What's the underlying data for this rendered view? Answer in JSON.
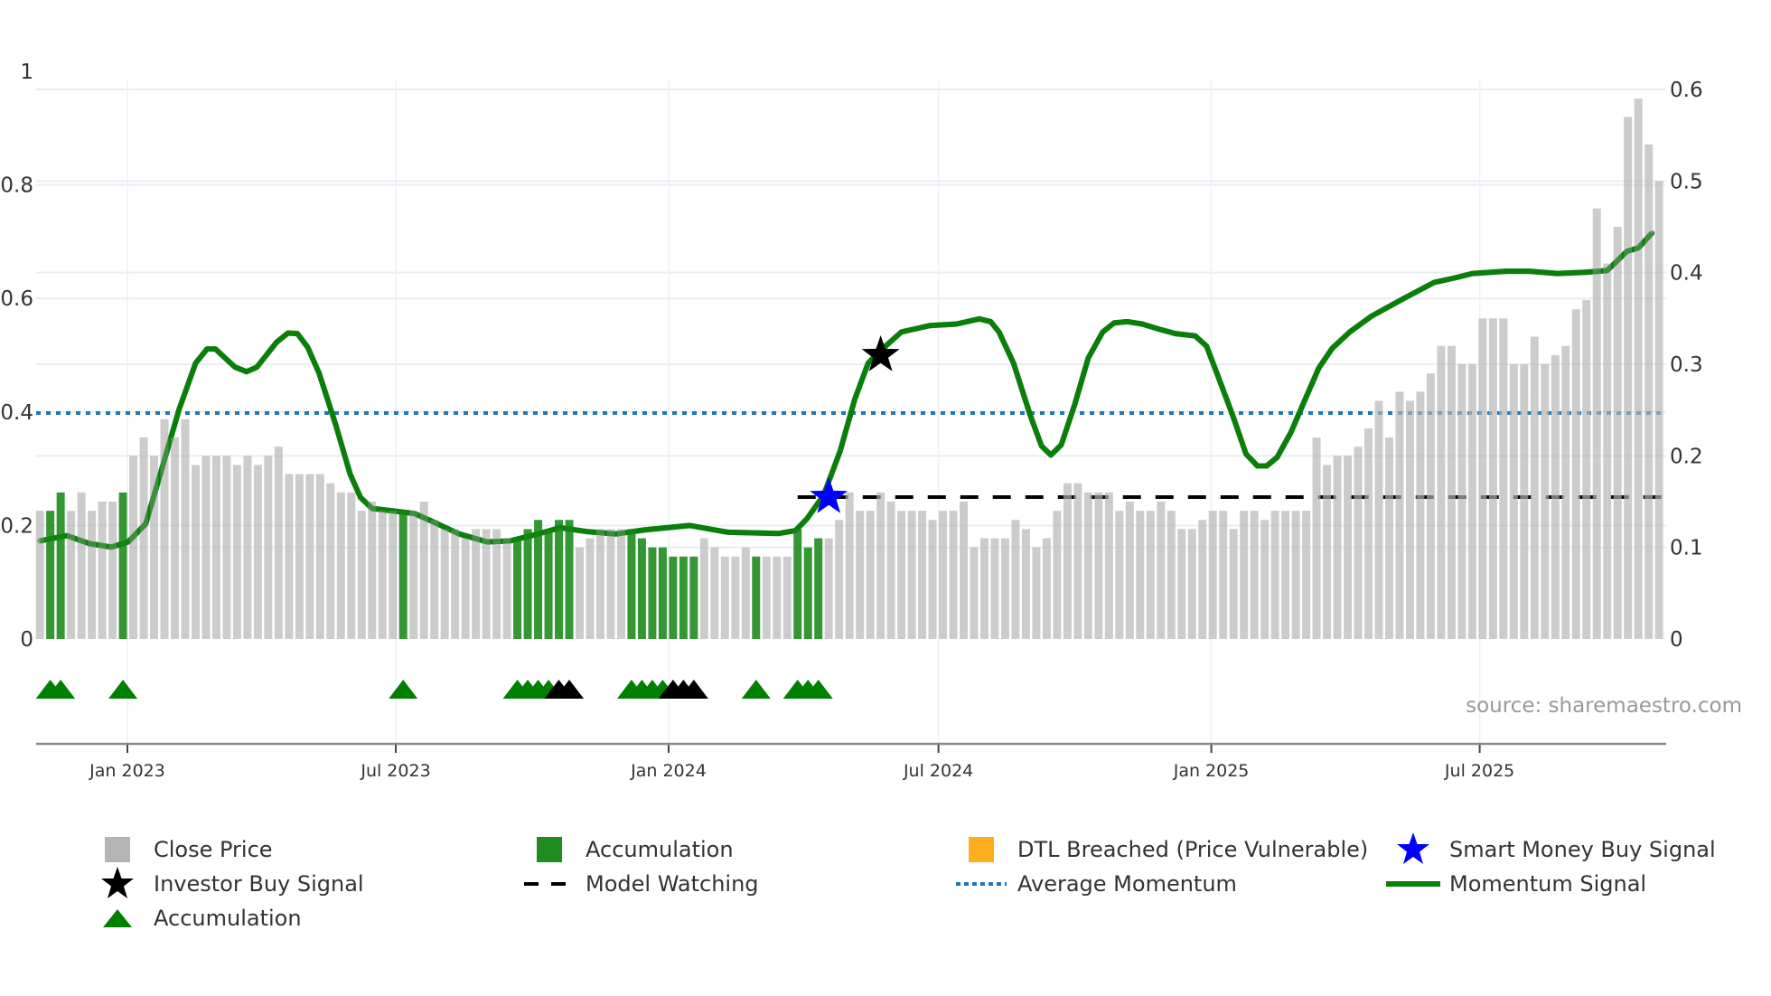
{
  "chart_data": {
    "type": "bar",
    "title": "",
    "source_label": "source: sharemaestro.com",
    "x_axis": {
      "type": "date",
      "ticks": [
        {
          "date": "2023-01-01",
          "label": "Jan 2023"
        },
        {
          "date": "2023-07-01",
          "label": "Jul 2023"
        },
        {
          "date": "2024-01-01",
          "label": "Jan 2024"
        },
        {
          "date": "2024-07-01",
          "label": "Jul 2024"
        },
        {
          "date": "2025-01-01",
          "label": "Jan 2025"
        },
        {
          "date": "2025-07-01",
          "label": "Jul 2025"
        }
      ]
    },
    "left_axis": {
      "range": [
        0,
        1
      ],
      "ticks": [
        "0",
        "0.2",
        "0.4",
        "0.6",
        "0.8",
        "1"
      ],
      "tick_values": [
        0,
        0.2,
        0.4,
        0.6,
        0.8,
        1
      ]
    },
    "right_axis": {
      "range": [
        0,
        0.6
      ],
      "ticks": [
        "0",
        "0.1",
        "0.2",
        "0.3",
        "0.4",
        "0.5",
        "0.6"
      ],
      "tick_values": [
        0,
        0.1,
        0.2,
        0.3,
        0.4,
        0.5,
        0.6
      ]
    },
    "close_price": {
      "axis": "right",
      "start_date": "2022-11-03",
      "interval_days": 7,
      "values": [
        0.14,
        0.14,
        0.16,
        0.14,
        0.16,
        0.14,
        0.15,
        0.15,
        0.16,
        0.2,
        0.22,
        0.2,
        0.24,
        0.22,
        0.24,
        0.19,
        0.2,
        0.2,
        0.2,
        0.19,
        0.2,
        0.19,
        0.2,
        0.21,
        0.18,
        0.18,
        0.18,
        0.18,
        0.17,
        0.16,
        0.16,
        0.14,
        0.15,
        0.14,
        0.14,
        0.14,
        0.14,
        0.15,
        0.13,
        0.12,
        0.12,
        0.11,
        0.12,
        0.12,
        0.12,
        0.11,
        0.11,
        0.12,
        0.13,
        0.12,
        0.13,
        0.13,
        0.1,
        0.11,
        0.12,
        0.12,
        0.12,
        0.12,
        0.11,
        0.1,
        0.1,
        0.09,
        0.09,
        0.09,
        0.11,
        0.1,
        0.09,
        0.09,
        0.1,
        0.09,
        0.09,
        0.09,
        0.09,
        0.12,
        0.1,
        0.11,
        0.11,
        0.13,
        0.16,
        0.14,
        0.14,
        0.16,
        0.15,
        0.14,
        0.14,
        0.14,
        0.13,
        0.14,
        0.14,
        0.15,
        0.1,
        0.11,
        0.11,
        0.11,
        0.13,
        0.12,
        0.1,
        0.11,
        0.14,
        0.17,
        0.17,
        0.16,
        0.16,
        0.16,
        0.14,
        0.15,
        0.14,
        0.14,
        0.15,
        0.14,
        0.12,
        0.12,
        0.13,
        0.14,
        0.14,
        0.12,
        0.14,
        0.14,
        0.13,
        0.14,
        0.14,
        0.14,
        0.14,
        0.22,
        0.19,
        0.2,
        0.2,
        0.21,
        0.23,
        0.26,
        0.22,
        0.27,
        0.26,
        0.27,
        0.29,
        0.32,
        0.32,
        0.3,
        0.3,
        0.35,
        0.35,
        0.35,
        0.3,
        0.3,
        0.33,
        0.3,
        0.31,
        0.32,
        0.36,
        0.37,
        0.47,
        0.41,
        0.45,
        0.57,
        0.59,
        0.54,
        0.5
      ]
    },
    "accumulation_bar_indices": [
      1,
      2,
      8,
      35,
      46,
      47,
      48,
      49,
      50,
      51,
      57,
      58,
      59,
      60,
      61,
      62,
      63,
      69,
      73,
      74,
      75
    ],
    "accumulation_markers": {
      "green": [
        1,
        2,
        8,
        35,
        46,
        47,
        48,
        49,
        57,
        58,
        59,
        60,
        69,
        73,
        74,
        75
      ],
      "black": [
        50,
        51,
        61,
        62,
        63
      ]
    },
    "momentum_signal": {
      "axis": "left",
      "points": [
        [
          0,
          0.173
        ],
        [
          2.6,
          0.182
        ],
        [
          4.8,
          0.168
        ],
        [
          6.9,
          0.162
        ],
        [
          8.5,
          0.171
        ],
        [
          10.2,
          0.203
        ],
        [
          11.8,
          0.303
        ],
        [
          13.4,
          0.404
        ],
        [
          15,
          0.486
        ],
        [
          16.1,
          0.511
        ],
        [
          16.9,
          0.511
        ],
        [
          18.8,
          0.479
        ],
        [
          19.9,
          0.471
        ],
        [
          20.9,
          0.479
        ],
        [
          22.8,
          0.523
        ],
        [
          23.9,
          0.539
        ],
        [
          24.8,
          0.538
        ],
        [
          25.8,
          0.514
        ],
        [
          26.9,
          0.468
        ],
        [
          28.5,
          0.377
        ],
        [
          29.9,
          0.29
        ],
        [
          30.9,
          0.249
        ],
        [
          32,
          0.23
        ],
        [
          33.9,
          0.226
        ],
        [
          36.1,
          0.221
        ],
        [
          37.7,
          0.208
        ],
        [
          40.4,
          0.185
        ],
        [
          43.1,
          0.171
        ],
        [
          45.3,
          0.173
        ],
        [
          48,
          0.185
        ],
        [
          50.1,
          0.196
        ],
        [
          52.8,
          0.189
        ],
        [
          55.5,
          0.185
        ],
        [
          58.2,
          0.192
        ],
        [
          62.6,
          0.2
        ],
        [
          66.3,
          0.188
        ],
        [
          71.2,
          0.186
        ],
        [
          72.8,
          0.191
        ],
        [
          73.9,
          0.212
        ],
        [
          75.5,
          0.253
        ],
        [
          77.1,
          0.331
        ],
        [
          78.5,
          0.422
        ],
        [
          79.8,
          0.486
        ],
        [
          80.8,
          0.505
        ],
        [
          83,
          0.541
        ],
        [
          85.7,
          0.552
        ],
        [
          88.3,
          0.555
        ],
        [
          90.5,
          0.564
        ],
        [
          91.6,
          0.559
        ],
        [
          92.4,
          0.541
        ],
        [
          93.8,
          0.486
        ],
        [
          95.4,
          0.395
        ],
        [
          96.5,
          0.34
        ],
        [
          97.4,
          0.324
        ],
        [
          98.4,
          0.342
        ],
        [
          99.7,
          0.413
        ],
        [
          101,
          0.495
        ],
        [
          102.4,
          0.541
        ],
        [
          103.5,
          0.557
        ],
        [
          104.8,
          0.559
        ],
        [
          106.2,
          0.555
        ],
        [
          107.8,
          0.546
        ],
        [
          109.4,
          0.538
        ],
        [
          111.3,
          0.534
        ],
        [
          112.4,
          0.516
        ],
        [
          113.4,
          0.468
        ],
        [
          114.9,
          0.395
        ],
        [
          116.2,
          0.326
        ],
        [
          117.3,
          0.305
        ],
        [
          118.2,
          0.305
        ],
        [
          119.2,
          0.32
        ],
        [
          120.5,
          0.363
        ],
        [
          121.9,
          0.422
        ],
        [
          123.2,
          0.477
        ],
        [
          124.5,
          0.512
        ],
        [
          126.2,
          0.541
        ],
        [
          128.3,
          0.569
        ],
        [
          131.5,
          0.601
        ],
        [
          134.3,
          0.628
        ],
        [
          136.5,
          0.637
        ],
        [
          138,
          0.644
        ],
        [
          141.3,
          0.648
        ],
        [
          143.5,
          0.648
        ],
        [
          146.2,
          0.644
        ],
        [
          148.9,
          0.646
        ],
        [
          151,
          0.649
        ],
        [
          152.9,
          0.683
        ],
        [
          154,
          0.689
        ],
        [
          155.3,
          0.715
        ]
      ]
    },
    "average_momentum": {
      "axis": "left",
      "value": 0.398
    },
    "model_watching": {
      "axis": "left",
      "value": 0.25,
      "start_index": 73
    },
    "smart_money_buy_signal": {
      "index": 76,
      "value": 0.25
    },
    "investor_buy_signal": {
      "index": 81,
      "value": 0.5
    },
    "colors": {
      "close_price": "#b4b4b4",
      "accumulation": "#1e8c1e",
      "dtl_breached": "#fdae1f",
      "smart_money": "#0000ff",
      "investor": "#000000",
      "model_watching": "#000000",
      "average_momentum": "#1f77b4",
      "momentum": "#0a7f0a",
      "marker_green": "#008000"
    },
    "legend": {
      "placement": "bottom",
      "items": [
        {
          "label": "Close Price",
          "icon": "gray-square"
        },
        {
          "label": "Accumulation",
          "icon": "green-bar"
        },
        {
          "label": "DTL Breached (Price Vulnerable)",
          "icon": "orange-bar"
        },
        {
          "label": "Smart Money Buy Signal",
          "icon": "blue-star"
        },
        {
          "label": "Investor Buy Signal",
          "icon": "black-star"
        },
        {
          "label": "Model Watching",
          "icon": "dashed-line"
        },
        {
          "label": "Average Momentum",
          "icon": "dotted-line"
        },
        {
          "label": "Momentum Signal",
          "icon": "solid-line"
        },
        {
          "label": "Accumulation",
          "icon": "green-triangle"
        }
      ]
    }
  }
}
